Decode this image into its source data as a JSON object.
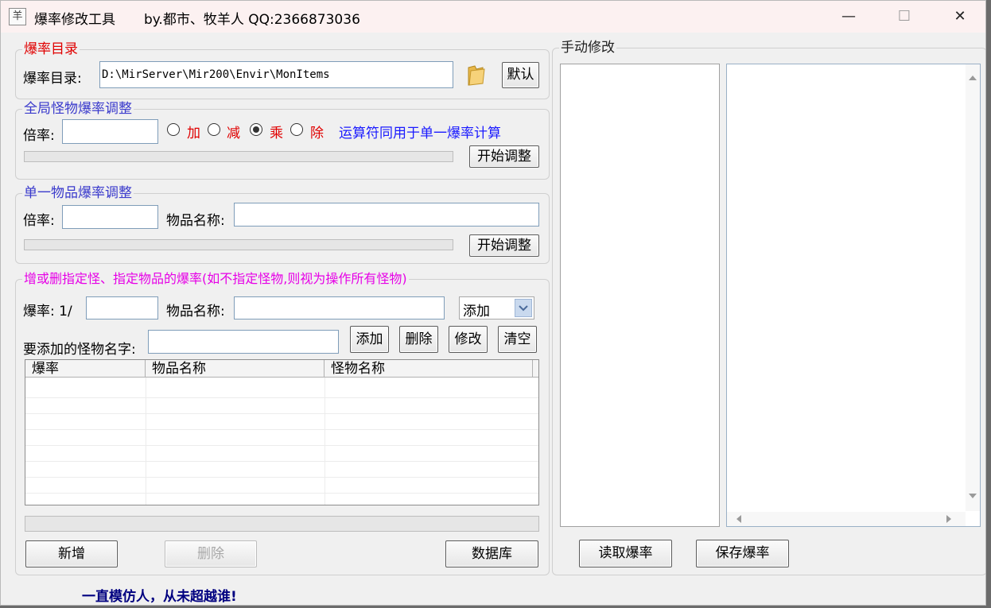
{
  "window": {
    "title": "爆率修改工具",
    "subtitle": "by.都市、牧羊人  QQ:2366873036",
    "icon": "sheep-icon",
    "minimize_glyph": "—",
    "maximize_glyph": "☐",
    "close_glyph": "✕"
  },
  "drop_dir": {
    "legend": "爆率目录",
    "label": "爆率目录:",
    "value": "D:\\MirServer\\Mir200\\Envir\\MonItems",
    "default_button": "默认",
    "folder_icon": "folder-icon"
  },
  "global_adjust": {
    "legend": "全局怪物爆率调整",
    "rate_label": "倍率:",
    "rate_value": "",
    "ops": [
      {
        "label": "加",
        "checked": false
      },
      {
        "label": "减",
        "checked": false
      },
      {
        "label": "乘",
        "checked": true
      },
      {
        "label": "除",
        "checked": false
      }
    ],
    "note": "运算符同用于单一爆率计算",
    "start_button": "开始调整",
    "progress": 0
  },
  "single_adjust": {
    "legend": "单一物品爆率调整",
    "rate_label": "倍率:",
    "rate_value": "",
    "item_label": "物品名称:",
    "item_value": "",
    "start_button": "开始调整",
    "progress": 0
  },
  "add_delete": {
    "legend": "增或删指定怪、指定物品的爆率(如不指定怪物,则视为操作所有怪物)",
    "rate_label": "爆率: 1/",
    "rate_value": "",
    "item_label": "物品名称:",
    "item_value": "",
    "action_select": "添加",
    "monster_label": "要添加的怪物名字:",
    "monster_value": "",
    "add_button": "添加",
    "delete_button": "删除",
    "modify_button": "修改",
    "clear_button": "清空",
    "table_headers": [
      "爆率",
      "物品名称",
      "怪物名称"
    ],
    "table_rows": [],
    "progress": 0,
    "new_button": "新增",
    "delete2_button": "删除",
    "database_button": "数据库"
  },
  "manual": {
    "legend": "手动修改",
    "read_button": "读取爆率",
    "save_button": "保存爆率"
  },
  "footer": {
    "text": "一直模仿人，从未超越谁!"
  },
  "colors": {
    "red_legend": "#e00000",
    "blue_legend": "#3a3acc",
    "magenta_legend": "#e600e6",
    "op_label": "#e00000",
    "note": "#1a1aff",
    "footer": "#000080"
  }
}
